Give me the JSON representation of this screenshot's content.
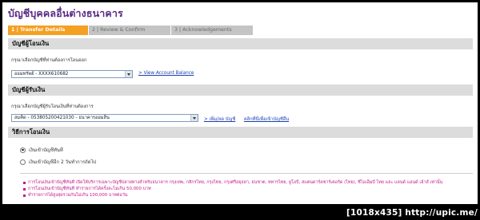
{
  "page": {
    "title": "บัญชีบุคคลอื่นต่างธนาคาร"
  },
  "steps": [
    {
      "label": "1 | Transfer Details"
    },
    {
      "label": "2 | Review & Confirm"
    },
    {
      "label": "3 | Acknowledgements"
    }
  ],
  "from_account": {
    "heading": "บัญชีผู้โอนเงิน",
    "instruction": "กรุณาเลือกบัญชีที่ท่านต้องการโอนออก",
    "selected": "ออมทรัพย์ - XXXX610682",
    "link": "> View Account Balance"
  },
  "to_account": {
    "heading": "บัญชีผู้รับเงิน",
    "instruction": "กรุณาเลือกบัญชีผู้รับโอนเงินที่ท่านต้องการ",
    "selected": "สมคิด - 053805200421030 - ธนาคารออมสิน",
    "link_add": "> เพิ่ม/ลด บัญชี",
    "link_other": "คลิกที่นี่เพื่อเข้าบัญชีอื่น"
  },
  "method": {
    "heading": "วิธีการโอนเงิน",
    "options": [
      {
        "label": "เงินเข้าบัญชีทันที",
        "checked": true
      },
      {
        "label": "เงินเข้าบัญชีอีก 2 วันทำการถัดไป",
        "checked": false
      }
    ]
  },
  "notes": [
    "การโอนเงินเข้าบัญชีทันที เปิดให้บริการเฉพาะบัญชีปลายทางสำหรับธนาคาร กรุงเทพ, กสิกรไทย, กรุงไทย, กรุงศรีอยุธยา, ธนชาต, ทหารไทย, ยูโอบี, สแตนดาร์ดชาร์เตอร์ด (ไทย), ซีไอเอ็มบี ไทย และ แลนด์ แอนด์ เฮ้าส์ เท่านั้น",
    "การโอนเงินเข้าบัญชีทันที ทำรายการได้ครั้งละไม่เกิน 50,000 บาท",
    "ทำรายการได้สูงสุดรวมกันไม่เกิน 100,000 บาทต่อวัน"
  ],
  "watermark": "[1018x435]  http://upic.me/"
}
